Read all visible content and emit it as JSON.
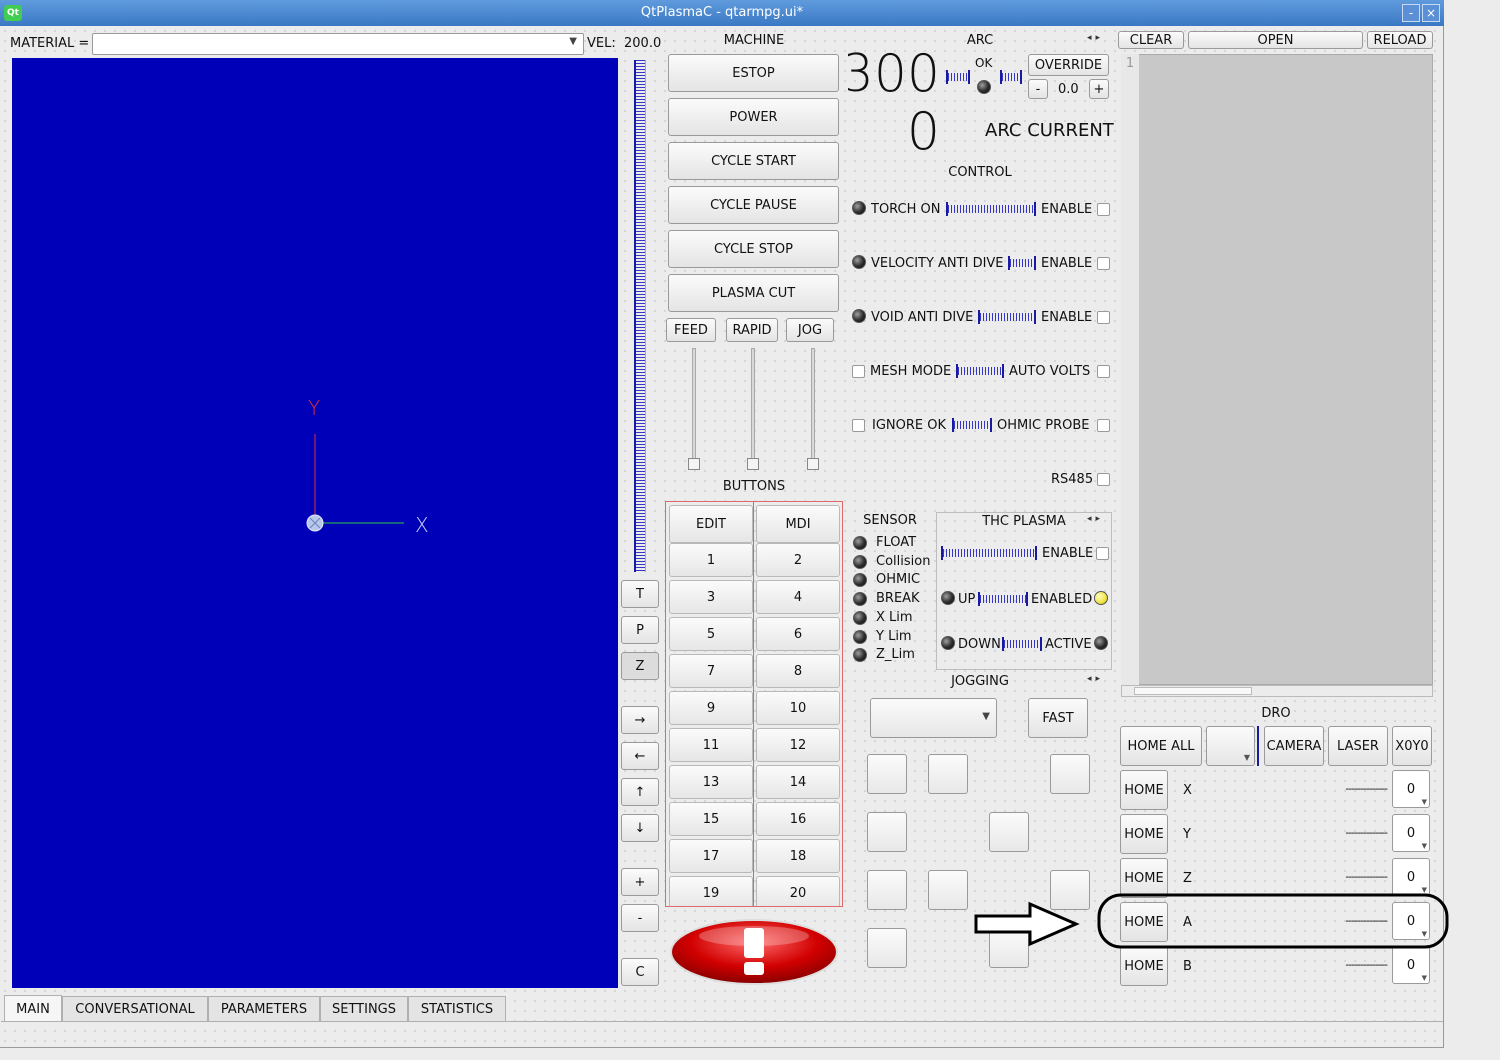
{
  "window": {
    "title": "QtPlasmaC - qtarmpg.ui*",
    "logo": "Qt",
    "minimize": "-",
    "close": "×"
  },
  "material": {
    "label": "MATERIAL =",
    "value": ""
  },
  "velocity": {
    "label": "VEL:",
    "value": "200.0"
  },
  "preview": {
    "axis_x": "X",
    "axis_y": "Y",
    "colors": {
      "background": "#0000b8",
      "x_axis": "#2ecc40",
      "y_axis": "#e03030"
    }
  },
  "side_buttons": [
    "T",
    "P",
    "Z",
    "→",
    "←",
    "↑",
    "↓",
    "+",
    "-",
    "C"
  ],
  "machine": {
    "title": "MACHINE",
    "buttons": [
      "ESTOP",
      "POWER",
      "CYCLE START",
      "CYCLE PAUSE",
      "CYCLE STOP",
      "PLASMA CUT"
    ],
    "overrides": [
      "FEED",
      "RAPID",
      "JOG"
    ]
  },
  "buttons_panel": {
    "title": "BUTTONS",
    "edit": "EDIT",
    "mdi": "MDI",
    "numbers": [
      "1",
      "2",
      "3",
      "4",
      "5",
      "6",
      "7",
      "8",
      "9",
      "10",
      "11",
      "12",
      "13",
      "14",
      "15",
      "16",
      "17",
      "18",
      "19",
      "20"
    ]
  },
  "arc": {
    "title": "ARC",
    "voltage": "300",
    "current": "0",
    "ok_label": "OK",
    "override": "OVERRIDE",
    "minus": "-",
    "override_value": "0.0",
    "plus": "+",
    "current_label": "ARC CURRENT"
  },
  "control": {
    "title": "CONTROL",
    "rows": [
      {
        "left": "TORCH ON",
        "right": "ENABLE"
      },
      {
        "left": "VELOCITY ANTI DIVE",
        "right": "ENABLE"
      },
      {
        "left": "VOID ANTI DIVE",
        "right": "ENABLE"
      },
      {
        "left": "MESH MODE",
        "right": "AUTO VOLTS"
      },
      {
        "left": "IGNORE OK",
        "right": "OHMIC PROBE"
      }
    ],
    "rs485": "RS485"
  },
  "sensor": {
    "title": "SENSOR",
    "items": [
      "FLOAT",
      "Collision",
      "OHMIC",
      "BREAK",
      "X Lim",
      "Y Lim",
      "Z_Lim"
    ]
  },
  "thc": {
    "title": "THC PLASMA",
    "enable": "ENABLE",
    "up": "UP",
    "enabled": "ENABLED",
    "down": "DOWN",
    "active": "ACTIVE",
    "enabled_led_color": "#f2e640"
  },
  "jogging": {
    "title": "JOGGING",
    "fast": "FAST",
    "increment": ""
  },
  "file": {
    "clear": "CLEAR",
    "open": "OPEN",
    "reload": "RELOAD",
    "line_number": "1"
  },
  "dro": {
    "title": "DRO",
    "home_all": "HOME ALL",
    "camera": "CAMERA",
    "laser": "LASER",
    "x0y0": "X0Y0",
    "axes": [
      {
        "home": "HOME",
        "axis": "X",
        "value": "--------------",
        "offset": "0"
      },
      {
        "home": "HOME",
        "axis": "Y",
        "value": "--------------",
        "offset": "0"
      },
      {
        "home": "HOME",
        "axis": "Z",
        "value": "--------------",
        "offset": "0"
      },
      {
        "home": "HOME",
        "axis": "A",
        "value": "--------------",
        "offset": "0"
      },
      {
        "home": "HOME",
        "axis": "B",
        "value": "--------------",
        "offset": "0"
      }
    ]
  },
  "tabs": [
    "MAIN",
    "CONVERSATIONAL",
    "PARAMETERS",
    "SETTINGS",
    "STATISTICS"
  ]
}
